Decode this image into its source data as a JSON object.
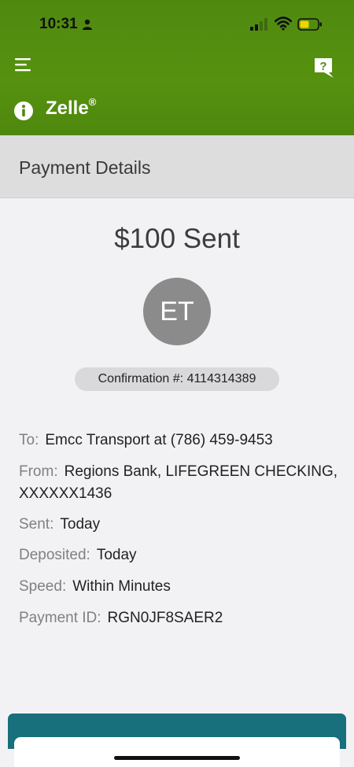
{
  "status_bar": {
    "time": "10:31"
  },
  "header": {
    "app_name": "Zelle",
    "trademark": "®",
    "help_glyph": "?"
  },
  "subheader": {
    "title": "Payment Details"
  },
  "payment": {
    "amount_text": "$100 Sent",
    "avatar_initials": "ET",
    "confirmation": "Confirmation #: 4114314389",
    "details": [
      {
        "label": "To:",
        "value": "Emcc Transport at (786) 459-9453"
      },
      {
        "label": "From:",
        "value": "Regions Bank, LIFEGREEN CHECKING, XXXXXX1436"
      },
      {
        "label": "Sent:",
        "value": "Today"
      },
      {
        "label": "Deposited:",
        "value": "Today"
      },
      {
        "label": "Speed:",
        "value": "Within Minutes"
      },
      {
        "label": "Payment ID:",
        "value": "RGN0JF8SAER2"
      }
    ]
  },
  "footer": {
    "button_label": ""
  },
  "colors": {
    "header_green": "#56910f",
    "button_teal": "#17707c",
    "avatar_gray": "#8b8b8b"
  }
}
